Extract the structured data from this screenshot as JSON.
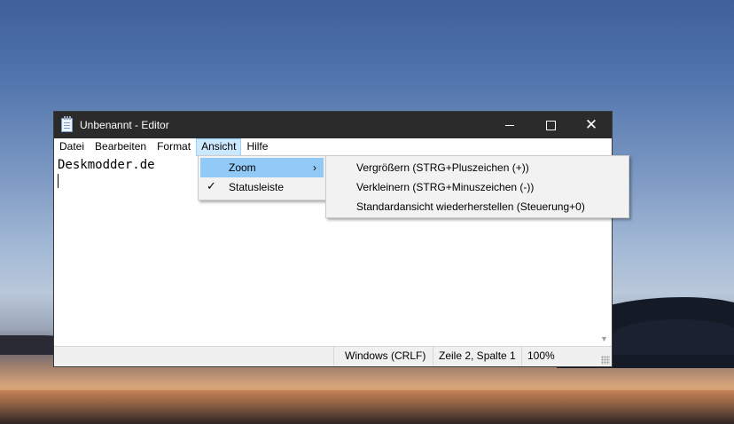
{
  "window": {
    "title": "Unbenannt - Editor",
    "minimize_label": "—",
    "maximize_label": "☐",
    "close_label": "✕"
  },
  "menubar": {
    "items": [
      {
        "label": "Datei"
      },
      {
        "label": "Bearbeiten"
      },
      {
        "label": "Format"
      },
      {
        "label": "Ansicht",
        "active": true
      },
      {
        "label": "Hilfe"
      }
    ]
  },
  "editor": {
    "text": "Deskmodder.de"
  },
  "ansicht_menu": {
    "items": [
      {
        "label": "Zoom",
        "has_submenu": true,
        "highlighted": true
      },
      {
        "label": "Statusleiste",
        "checked": true
      }
    ],
    "submenu_arrow": "›",
    "check_glyph": "✓"
  },
  "zoom_submenu": {
    "items": [
      {
        "label": "Vergrößern (STRG+Pluszeichen (+))"
      },
      {
        "label": "Verkleinern (STRG+Minuszeichen (-))"
      },
      {
        "label": "Standardansicht wiederherstellen (Steuerung+0)"
      }
    ]
  },
  "statusbar": {
    "encoding": "Windows (CRLF)",
    "position": "Zeile 2, Spalte 1",
    "zoom": "100%"
  },
  "colors": {
    "titlebar": "#2b2b2b",
    "menu_highlight": "#91c9f7",
    "menubar_active": "#cce8ff"
  }
}
